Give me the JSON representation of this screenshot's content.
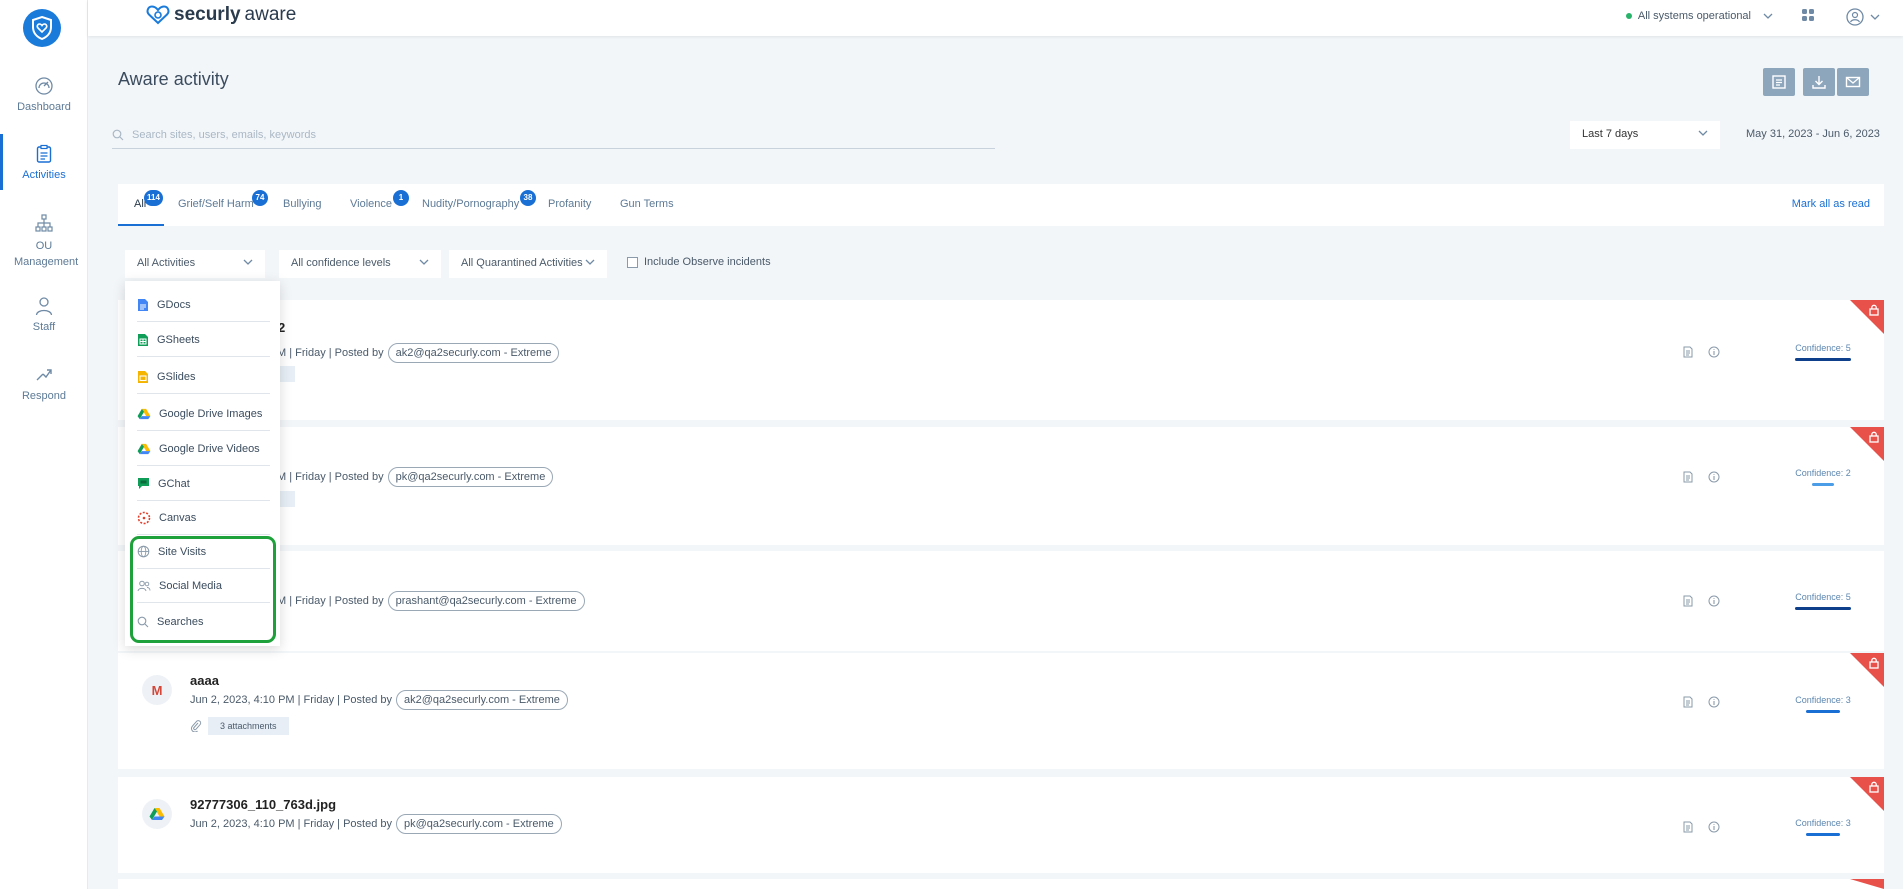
{
  "sidebar": {
    "items": [
      {
        "label": "Dashboard",
        "icon": "gauge-icon"
      },
      {
        "label": "Activities",
        "icon": "clipboard-icon"
      },
      {
        "label": "OU Management",
        "icon": "org-chart-icon"
      },
      {
        "label": "Staff",
        "icon": "person-icon"
      },
      {
        "label": "Respond",
        "icon": "respond-icon"
      }
    ]
  },
  "topbar": {
    "brand_bold": "securly",
    "brand_light": "aware",
    "status": "All systems operational"
  },
  "page": {
    "title": "Aware activity"
  },
  "search": {
    "placeholder": "Search sites, users, emails, keywords"
  },
  "date_range": {
    "selected": "Last 7 days",
    "text": "May 31, 2023 -  Jun 6, 2023"
  },
  "tabs": [
    {
      "label": "All",
      "badge": "114"
    },
    {
      "label": "Grief/Self Harm",
      "badge": "74"
    },
    {
      "label": "Bullying",
      "badge": ""
    },
    {
      "label": "Violence",
      "badge": "1"
    },
    {
      "label": "Nudity/Pornography",
      "badge": "38"
    },
    {
      "label": "Profanity",
      "badge": ""
    },
    {
      "label": "Gun Terms",
      "badge": ""
    }
  ],
  "mark_all_read": "Mark all as read",
  "filters": {
    "activities": "All Activities",
    "confidence": "All confidence levels",
    "quarantined": "All Quarantined Activities",
    "observe": "Include Observe incidents"
  },
  "dropdown": {
    "items": [
      {
        "label": "GDocs",
        "icon": "gdocs-icon"
      },
      {
        "label": "GSheets",
        "icon": "gsheets-icon"
      },
      {
        "label": "GSlides",
        "icon": "gslides-icon"
      },
      {
        "label": "Google Drive Images",
        "icon": "google-drive-icon"
      },
      {
        "label": "Google Drive Videos",
        "icon": "google-drive-icon"
      },
      {
        "label": "GChat",
        "icon": "gchat-icon"
      },
      {
        "label": "Canvas",
        "icon": "canvas-icon"
      },
      {
        "label": "Site Visits",
        "icon": "globe-icon"
      },
      {
        "label": "Social Media",
        "icon": "people-icon"
      },
      {
        "label": "Searches",
        "icon": "search-icon"
      }
    ]
  },
  "cards": [
    {
      "title": "2",
      "date": "M | Friday | Posted by",
      "user": "ak2@qa2securly.com - Extreme",
      "confidence": "Confidence: 5",
      "attachments": ""
    },
    {
      "title": "",
      "date": "M | Friday | Posted by",
      "user": "pk@qa2securly.com - Extreme",
      "confidence": "Confidence: 2",
      "attachments": ""
    },
    {
      "title": "",
      "date": "M | Friday | Posted by",
      "user": "prashant@qa2securly.com - Extreme",
      "confidence": "Confidence: 5",
      "attachments": ""
    },
    {
      "title": "aaaa",
      "date": "Jun 2, 2023, 4:10 PM | Friday | Posted by",
      "user": "ak2@qa2securly.com - Extreme",
      "confidence": "Confidence: 3",
      "attachments": "3 attachments",
      "icon": "gmail-icon",
      "icon_text": "M"
    },
    {
      "title": "92777306_110_763d.jpg",
      "date": "Jun 2, 2023, 4:10 PM | Friday | Posted by",
      "user": "pk@qa2securly.com - Extreme",
      "confidence": "Confidence: 3",
      "attachments": "",
      "icon": "google-drive-icon"
    }
  ],
  "colors": {
    "accent": "#1a6fd4",
    "confidence_dark": "#0d3f8a",
    "confidence_light": "#4a9de6",
    "lock_corner": "#e8514a",
    "highlight": "#1ea13a"
  }
}
